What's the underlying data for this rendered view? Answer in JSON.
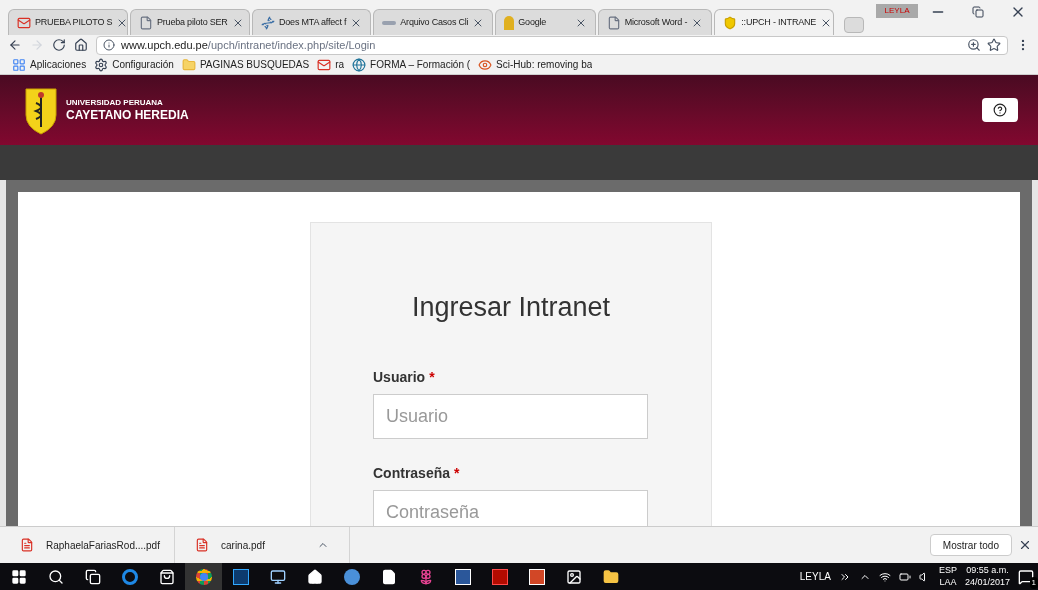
{
  "browser": {
    "tabs": [
      {
        "title": "PRUEBA PILOTO S",
        "selected": false
      },
      {
        "title": "Prueba piloto SER",
        "selected": false
      },
      {
        "title": "Does MTA affect f",
        "selected": false
      },
      {
        "title": "Arquivo Casos Cli",
        "selected": false
      },
      {
        "title": "Google",
        "selected": false
      },
      {
        "title": "Microsoft Word -",
        "selected": false
      },
      {
        "title": "::UPCH - INTRANE",
        "selected": true
      }
    ],
    "profile": "LEYLA",
    "address": {
      "host": "www.upch.edu.pe",
      "path": "/upch/intranet/index.php/site/Login"
    },
    "bookmarks": [
      {
        "label": "Aplicaciones"
      },
      {
        "label": "Configuración"
      },
      {
        "label": "PAGINAS BUSQUEDAS"
      },
      {
        "label": "ra"
      },
      {
        "label": "FORMA – Formación ("
      },
      {
        "label": "Sci-Hub: removing ba"
      }
    ]
  },
  "header": {
    "subtitle": "UNIVERSIDAD PERUANA",
    "name": "CAYETANO HEREDIA"
  },
  "login": {
    "title": "Ingresar Intranet",
    "fields": [
      {
        "label": "Usuario",
        "required_mark": "*",
        "placeholder": "Usuario"
      },
      {
        "label": "Contraseña",
        "required_mark": "*",
        "placeholder": "Contraseña"
      }
    ]
  },
  "downloads": {
    "items": [
      {
        "name": "RaphaelaFariasRod....pdf"
      },
      {
        "name": "carina.pdf"
      }
    ],
    "show_all": "Mostrar todo"
  },
  "taskbar": {
    "user": "LEYLA",
    "lang": "ESP",
    "layout": "LAA",
    "time": "09:55 a.m.",
    "date": "24/01/2017",
    "notifications": "1"
  }
}
